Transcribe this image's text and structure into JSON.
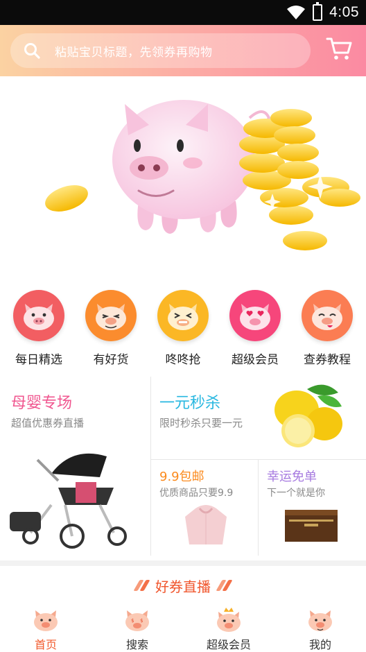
{
  "status_bar": {
    "time": "4:05"
  },
  "header": {
    "search_placeholder": "粘贴宝贝标题，先领券再购物",
    "colors": {
      "gradient_start": "#fbd2a2",
      "gradient_end": "#fb8aa2"
    }
  },
  "categories": [
    {
      "label": "每日精选",
      "color": "#f25e62",
      "icon": "pig-face-icon"
    },
    {
      "label": "有好货",
      "color": "#fb8c2e",
      "icon": "pig-face-icon"
    },
    {
      "label": "咚咚抢",
      "color": "#fbb725",
      "icon": "pig-face-icon"
    },
    {
      "label": "超级会员",
      "color": "#f6467b",
      "icon": "pig-face-icon"
    },
    {
      "label": "查券教程",
      "color": "#fb7d53",
      "icon": "pig-face-icon"
    }
  ],
  "promo": {
    "mother_baby": {
      "title": "母婴专场",
      "subtitle": "超值优惠券直播",
      "color": "#f0568f"
    },
    "flash_sale": {
      "title": "一元秒杀",
      "subtitle": "限时秒杀只要一元",
      "color": "#27b7e0"
    },
    "free_shipping": {
      "title": "9.9包邮",
      "subtitle": "优质商品只要9.9",
      "color": "#fb8a1d"
    },
    "lucky_free": {
      "title": "幸运免单",
      "subtitle": "下一个就是你",
      "color": "#a77be0"
    }
  },
  "live_section": {
    "title": "好券直播"
  },
  "bottom_nav": [
    {
      "label": "首页",
      "active": true
    },
    {
      "label": "搜索",
      "active": false
    },
    {
      "label": "超级会员",
      "active": false
    },
    {
      "label": "我的",
      "active": false
    }
  ]
}
